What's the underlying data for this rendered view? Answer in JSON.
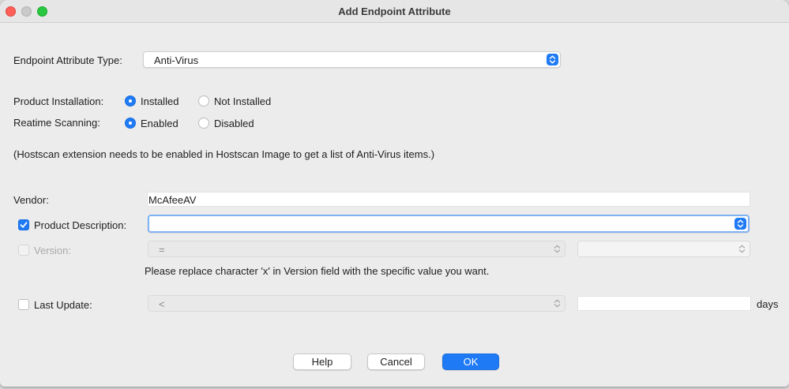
{
  "window": {
    "title": "Add Endpoint Attribute"
  },
  "attribute_type": {
    "label": "Endpoint Attribute Type:",
    "value": "Anti-Virus"
  },
  "product_installation": {
    "label": "Product Installation:",
    "options": [
      "Installed",
      "Not Installed"
    ],
    "selected": "Installed"
  },
  "realtime_scanning": {
    "label": "Reatime Scanning:",
    "options": [
      "Enabled",
      "Disabled"
    ],
    "selected": "Enabled"
  },
  "hint": "(Hostscan extension needs to be enabled in Hostscan Image to get a list of Anti-Virus items.)",
  "vendor": {
    "label": "Vendor:",
    "value": "McAfeeAV"
  },
  "product_description": {
    "label": "Product Description:",
    "checked": true,
    "value": ""
  },
  "version": {
    "label": "Version:",
    "checked": false,
    "enabled": false,
    "operator": "=",
    "value": "",
    "note": "Please replace character 'x' in Version field with the specific value you want."
  },
  "last_update": {
    "label": "Last Update:",
    "checked": false,
    "operator": "<",
    "value": "",
    "unit": "days"
  },
  "buttons": {
    "help": "Help",
    "cancel": "Cancel",
    "ok": "OK"
  },
  "colors": {
    "accent": "#1f7af5",
    "close": "#ff5f57",
    "maximize": "#28c840"
  },
  "icons": [
    "close-icon",
    "minimize-icon",
    "maximize-icon",
    "updown-chevron-icon",
    "checkmark-icon"
  ]
}
